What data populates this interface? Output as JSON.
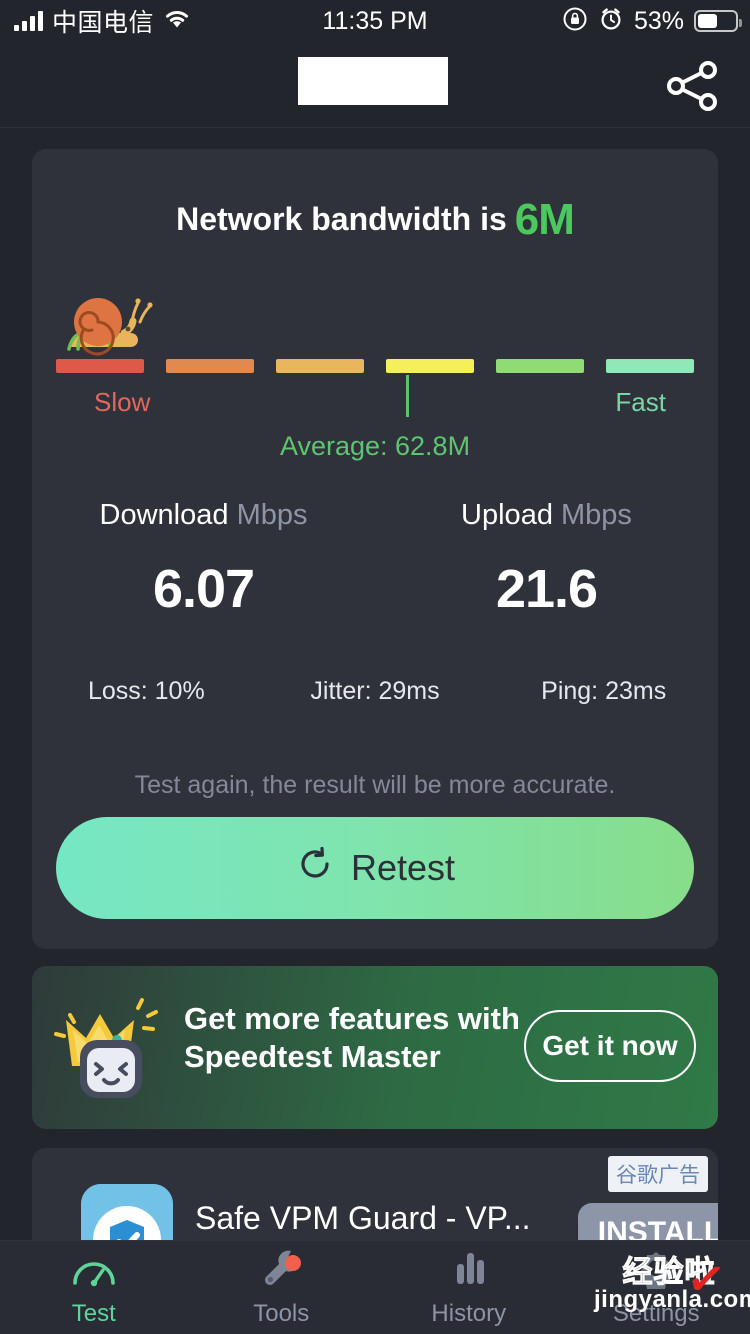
{
  "statusbar": {
    "carrier": "中国电信",
    "time": "11:35 PM",
    "battery_percent": "53%",
    "icons": [
      "signal-bars-icon",
      "wifi-icon",
      "rotation-lock-icon",
      "alarm-icon",
      "battery-icon"
    ]
  },
  "header": {
    "redacted_title": "",
    "share_icon": "share-icon"
  },
  "result": {
    "headline_prefix": "Network bandwidth is",
    "headline_value": "6M",
    "gauge": {
      "slow_label": "Slow",
      "fast_label": "Fast",
      "average_label": "Average: 62.8M",
      "snail_icon": "snail-icon",
      "segment_colors": [
        "#dd5a4a",
        "#e08a4f",
        "#e8b65c",
        "#f5ef5c",
        "#8fdc75",
        "#8ee8b8"
      ],
      "marker_position_percent": 55
    },
    "download": {
      "label": "Download",
      "unit": "Mbps",
      "value": "6.07"
    },
    "upload": {
      "label": "Upload",
      "unit": "Mbps",
      "value": "21.6"
    },
    "metrics": [
      {
        "name": "Loss",
        "text": "Loss: 10%"
      },
      {
        "name": "Jitter",
        "text": "Jitter: 29ms"
      },
      {
        "name": "Ping",
        "text": "Ping: 23ms"
      }
    ],
    "hint": "Test again, the result will be more accurate.",
    "retest_label": "Retest",
    "retest_icon": "refresh-icon"
  },
  "promo": {
    "line1": "Get more features with",
    "line2": "Speedtest Master",
    "button_label": "Get it now",
    "mascot_icon": "crowned-robot-icon"
  },
  "ad": {
    "badge": "谷歌广告",
    "title": "Safe VPM Guard - VP...",
    "install_label": "INSTALL",
    "icon": "shield-app-icon"
  },
  "nav": {
    "items": [
      {
        "label": "Test",
        "icon": "speedometer-icon",
        "active": true,
        "badge": false
      },
      {
        "label": "Tools",
        "icon": "wrench-icon",
        "active": false,
        "badge": true
      },
      {
        "label": "History",
        "icon": "bar-chart-icon",
        "active": false,
        "badge": false
      },
      {
        "label": "Settings",
        "icon": "gear-icon",
        "active": false,
        "badge": false
      }
    ]
  },
  "watermark": {
    "line1": "经验啦",
    "line2": "jingyanla.com"
  },
  "colors": {
    "background": "#22252c",
    "card": "#2f323b",
    "accent_green": "#4bc85e",
    "nav_active": "#5fd49a",
    "muted_text": "#8d94a3"
  }
}
